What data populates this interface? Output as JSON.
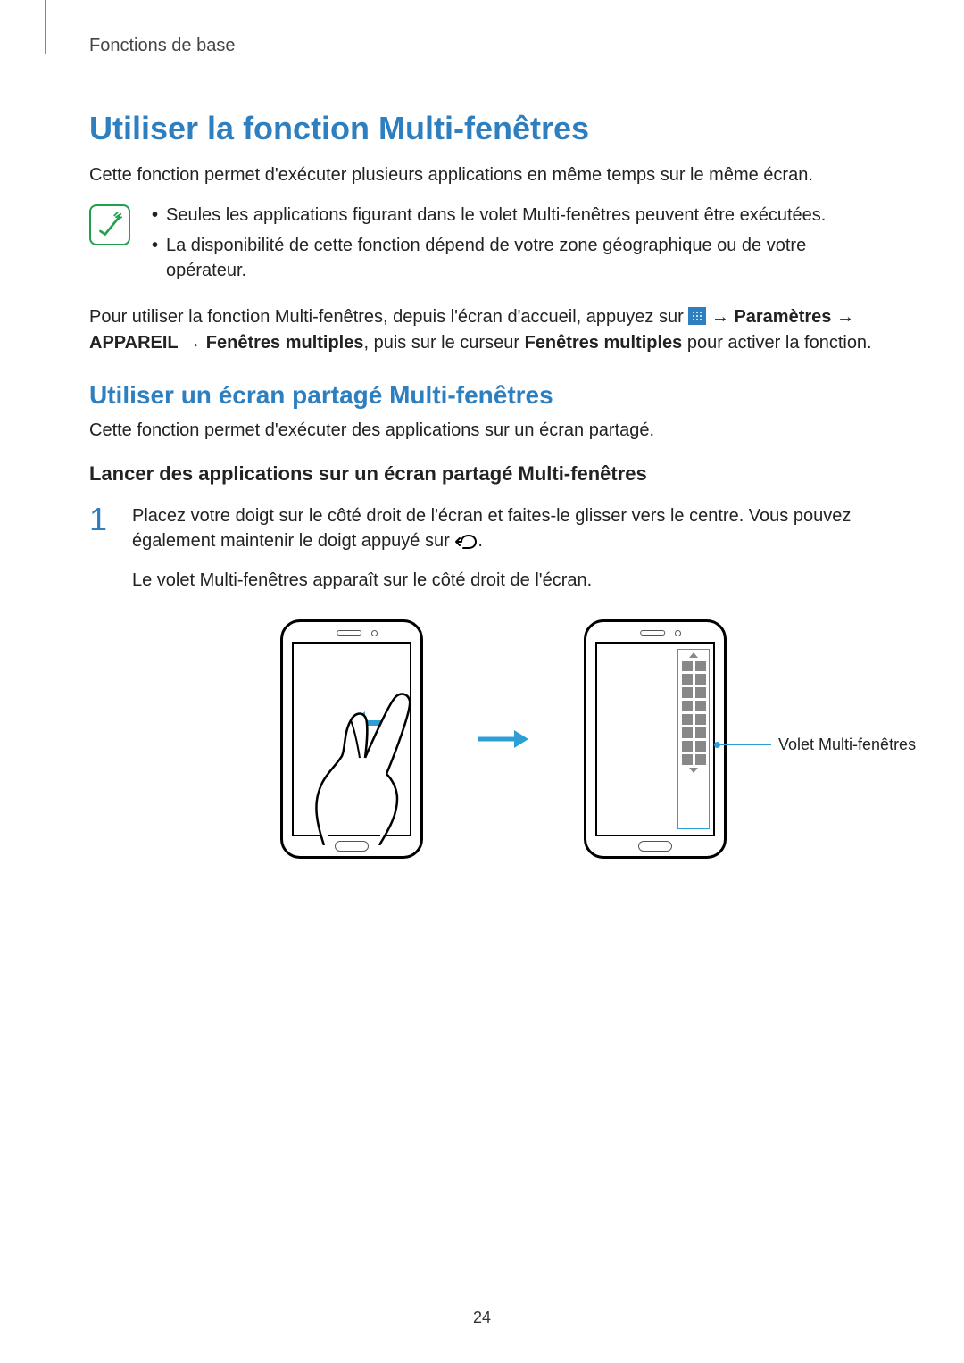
{
  "section_label": "Fonctions de base",
  "h1": "Utiliser la fonction Multi-fenêtres",
  "intro": "Cette fonction permet d'exécuter plusieurs applications en même temps sur le même écran.",
  "notes": [
    "Seules les applications figurant dans le volet Multi-fenêtres peuvent être exécutées.",
    "La disponibilité de cette fonction dépend de votre zone géographique ou de votre opérateur."
  ],
  "instr": {
    "pre": "Pour utiliser la fonction Multi-fenêtres, depuis l'écran d'accueil, appuyez sur ",
    "arrow": " → ",
    "settings": "Paramètres",
    "device": "APPAREIL",
    "multiwin": "Fenêtres multiples",
    "mid": ", puis sur le curseur ",
    "multiwin2": "Fenêtres multiples",
    "post": " pour activer la fonction."
  },
  "h2": "Utiliser un écran partagé Multi-fenêtres",
  "sub": "Cette fonction permet d'exécuter des applications sur un écran partagé.",
  "h3": "Lancer des applications sur un écran partagé Multi-fenêtres",
  "step1": {
    "num": "1",
    "line1_pre": "Placez votre doigt sur le côté droit de l'écran et faites-le glisser vers le centre. Vous pouvez également maintenir le doigt appuyé sur ",
    "line1_post": ".",
    "line2": "Le volet Multi-fenêtres apparaît sur le côté droit de l'écran."
  },
  "callout_label": "Volet Multi-fenêtres",
  "page_number": "24"
}
